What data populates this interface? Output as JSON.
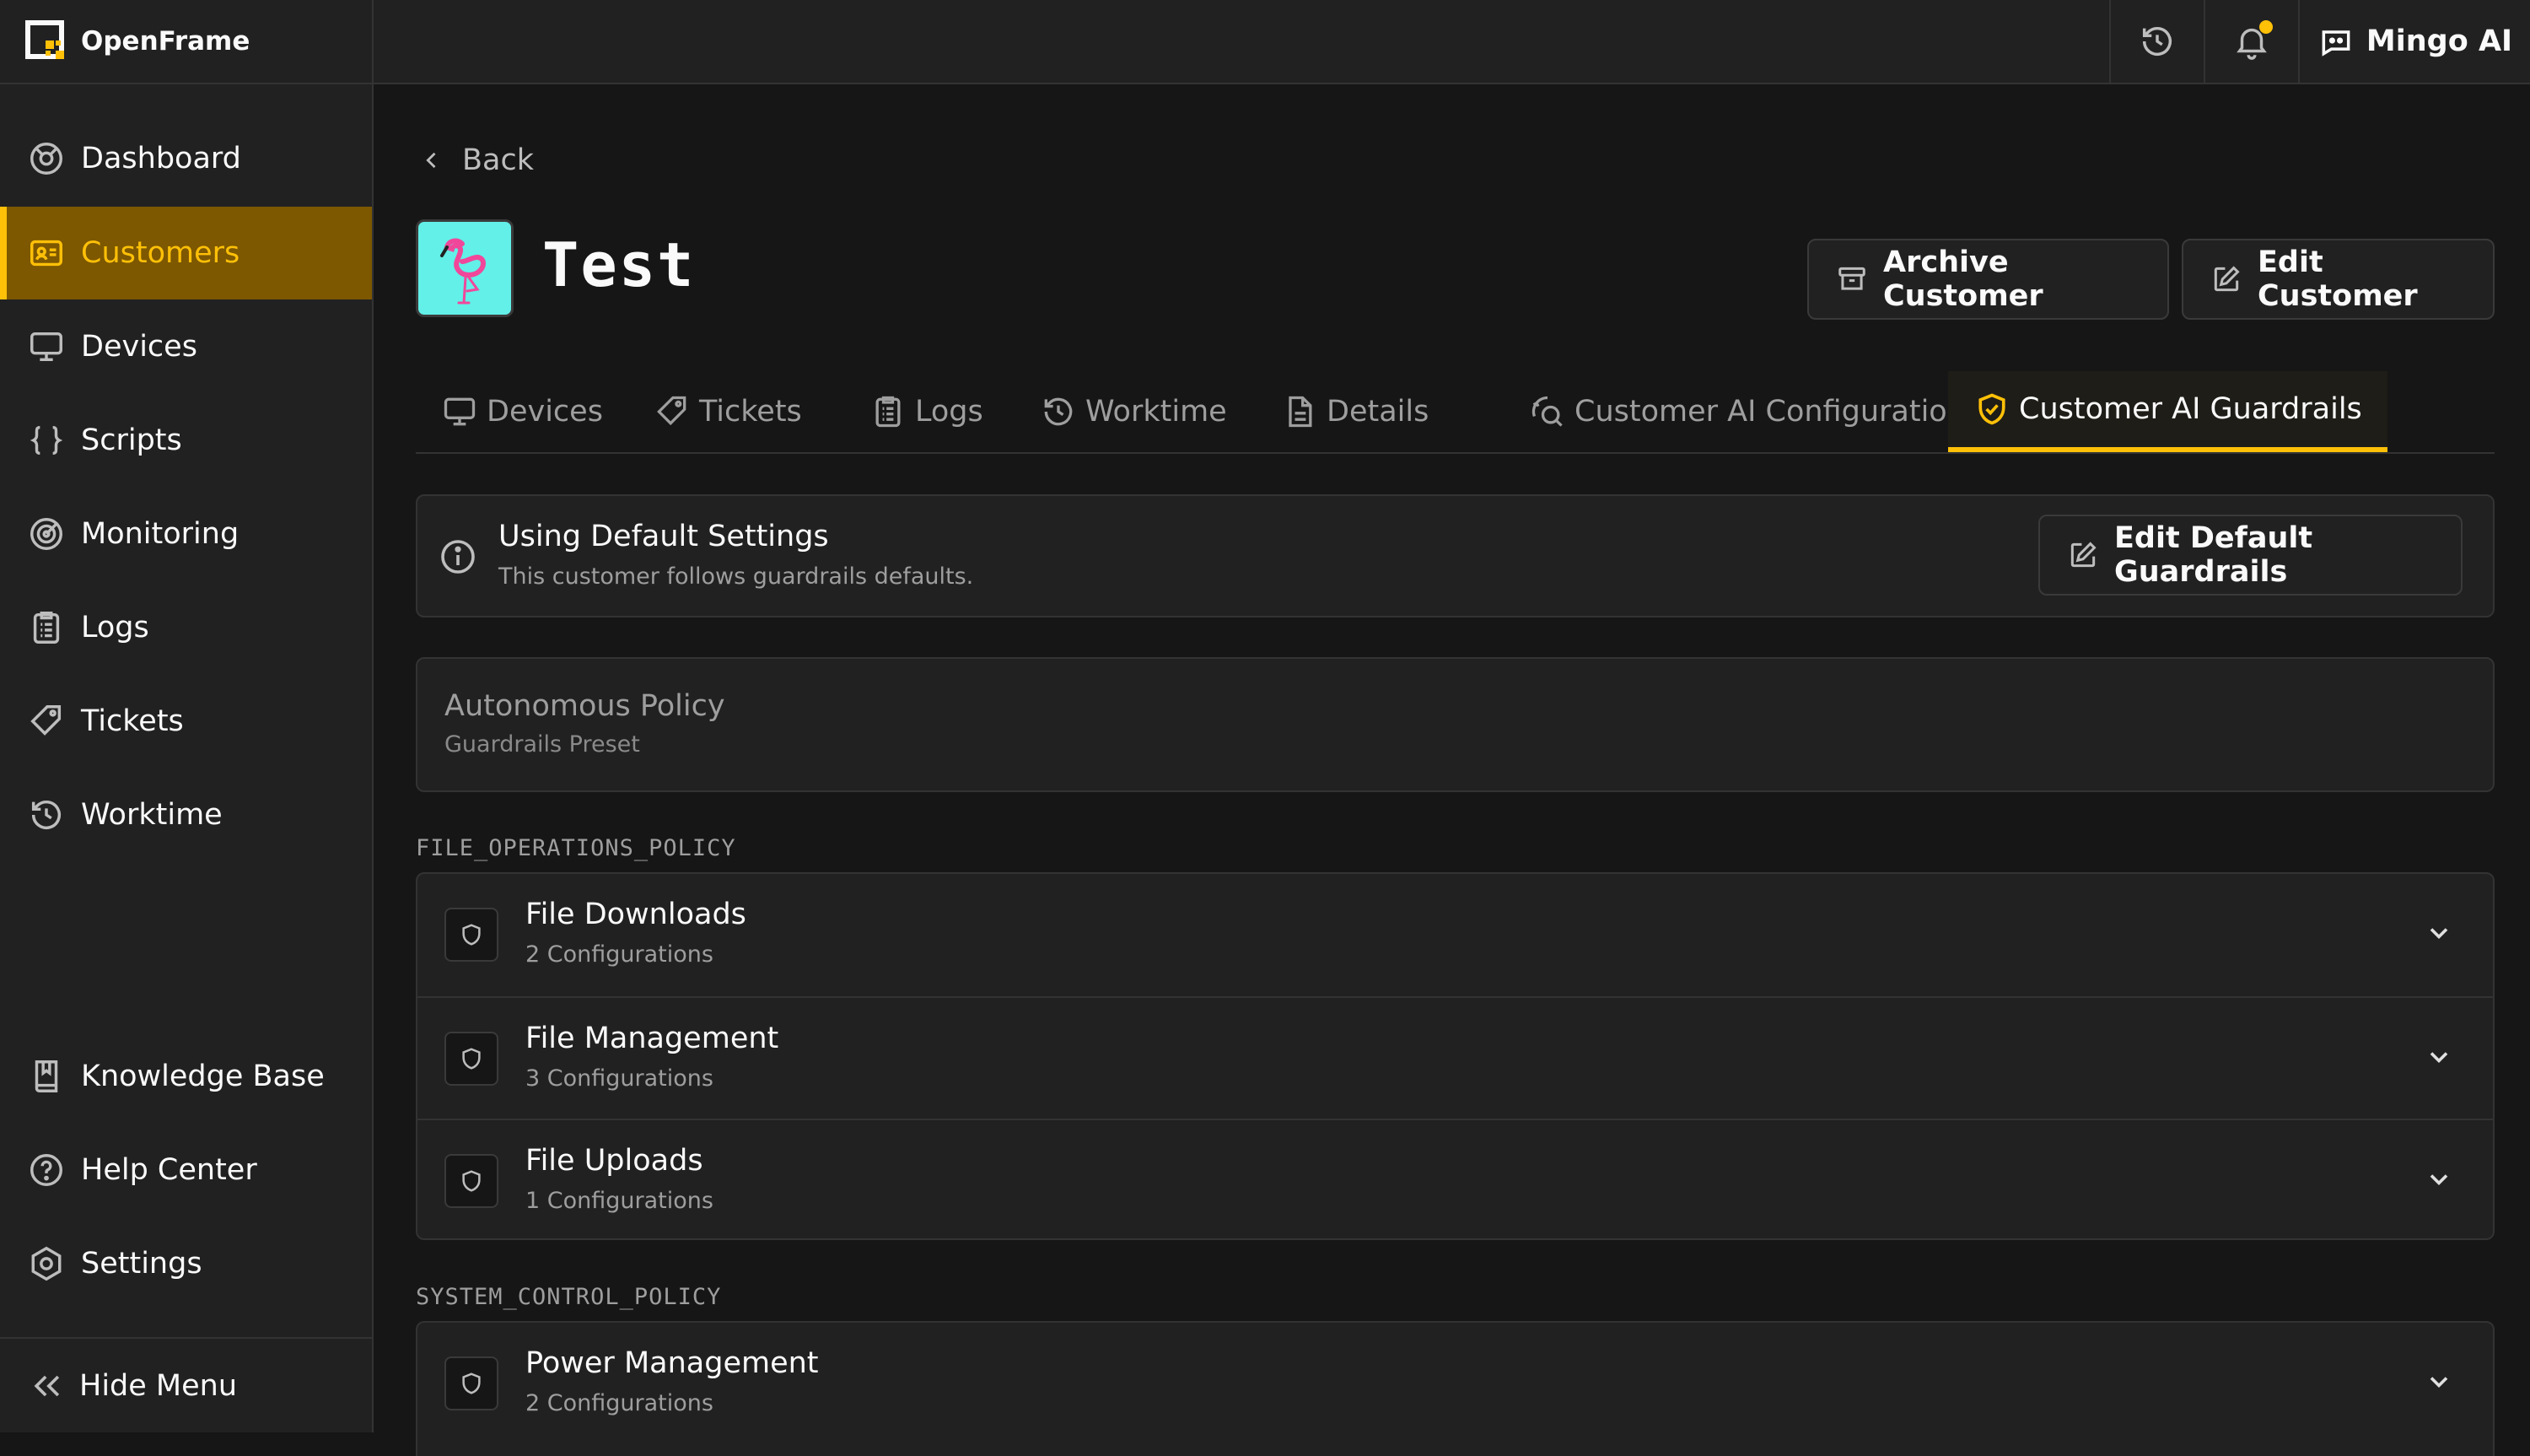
{
  "brand": {
    "name": "OpenFrame"
  },
  "sidebar": {
    "items": [
      {
        "label": "Dashboard",
        "icon": "dashboard-icon"
      },
      {
        "label": "Customers",
        "icon": "customers-icon",
        "active": true
      },
      {
        "label": "Devices",
        "icon": "monitor-icon"
      },
      {
        "label": "Scripts",
        "icon": "braces-icon"
      },
      {
        "label": "Monitoring",
        "icon": "target-icon"
      },
      {
        "label": "Logs",
        "icon": "logs-icon"
      },
      {
        "label": "Tickets",
        "icon": "tag-icon"
      },
      {
        "label": "Worktime",
        "icon": "history-icon"
      }
    ],
    "bottom_items": [
      {
        "label": "Knowledge Base",
        "icon": "book-icon"
      },
      {
        "label": "Help Center",
        "icon": "help-icon"
      },
      {
        "label": "Settings",
        "icon": "settings-icon"
      }
    ],
    "hide_menu": "Hide Menu"
  },
  "topbar": {
    "mingo_label": "Mingo AI",
    "notification_dot_color": "#ffc008"
  },
  "page": {
    "back": "Back",
    "title": "Test",
    "archive_button": "Archive Customer",
    "edit_button": "Edit Customer"
  },
  "tabs": [
    {
      "label": "Devices",
      "icon": "monitor-icon"
    },
    {
      "label": "Tickets",
      "icon": "tag-icon"
    },
    {
      "label": "Logs",
      "icon": "logs-icon"
    },
    {
      "label": "Worktime",
      "icon": "history-icon"
    },
    {
      "label": "Details",
      "icon": "file-icon"
    },
    {
      "label": "Customer AI Configuration",
      "icon": "ai-search-icon"
    },
    {
      "label": "Customer AI Guardrails",
      "icon": "shield-check-icon",
      "active": true
    }
  ],
  "info": {
    "title": "Using Default Settings",
    "subtitle": "This customer follows guardrails defaults.",
    "button": "Edit Default Guardrails"
  },
  "policy": {
    "title": "Autonomous Policy",
    "subtitle": "Guardrails Preset"
  },
  "sections": [
    {
      "label": "FILE_OPERATIONS_POLICY",
      "rows": [
        {
          "title": "File Downloads",
          "subtitle": "2 Configurations"
        },
        {
          "title": "File Management",
          "subtitle": "3 Configurations"
        },
        {
          "title": "File Uploads",
          "subtitle": "1 Configurations"
        }
      ]
    },
    {
      "label": "SYSTEM_CONTROL_POLICY",
      "rows": [
        {
          "title": "Power Management",
          "subtitle": "2 Configurations"
        }
      ]
    }
  ],
  "colors": {
    "accent": "#ffc008",
    "active_bg": "#7d5800",
    "avatar_bg": "#62f0e8",
    "flamingo": "#f0479a"
  }
}
